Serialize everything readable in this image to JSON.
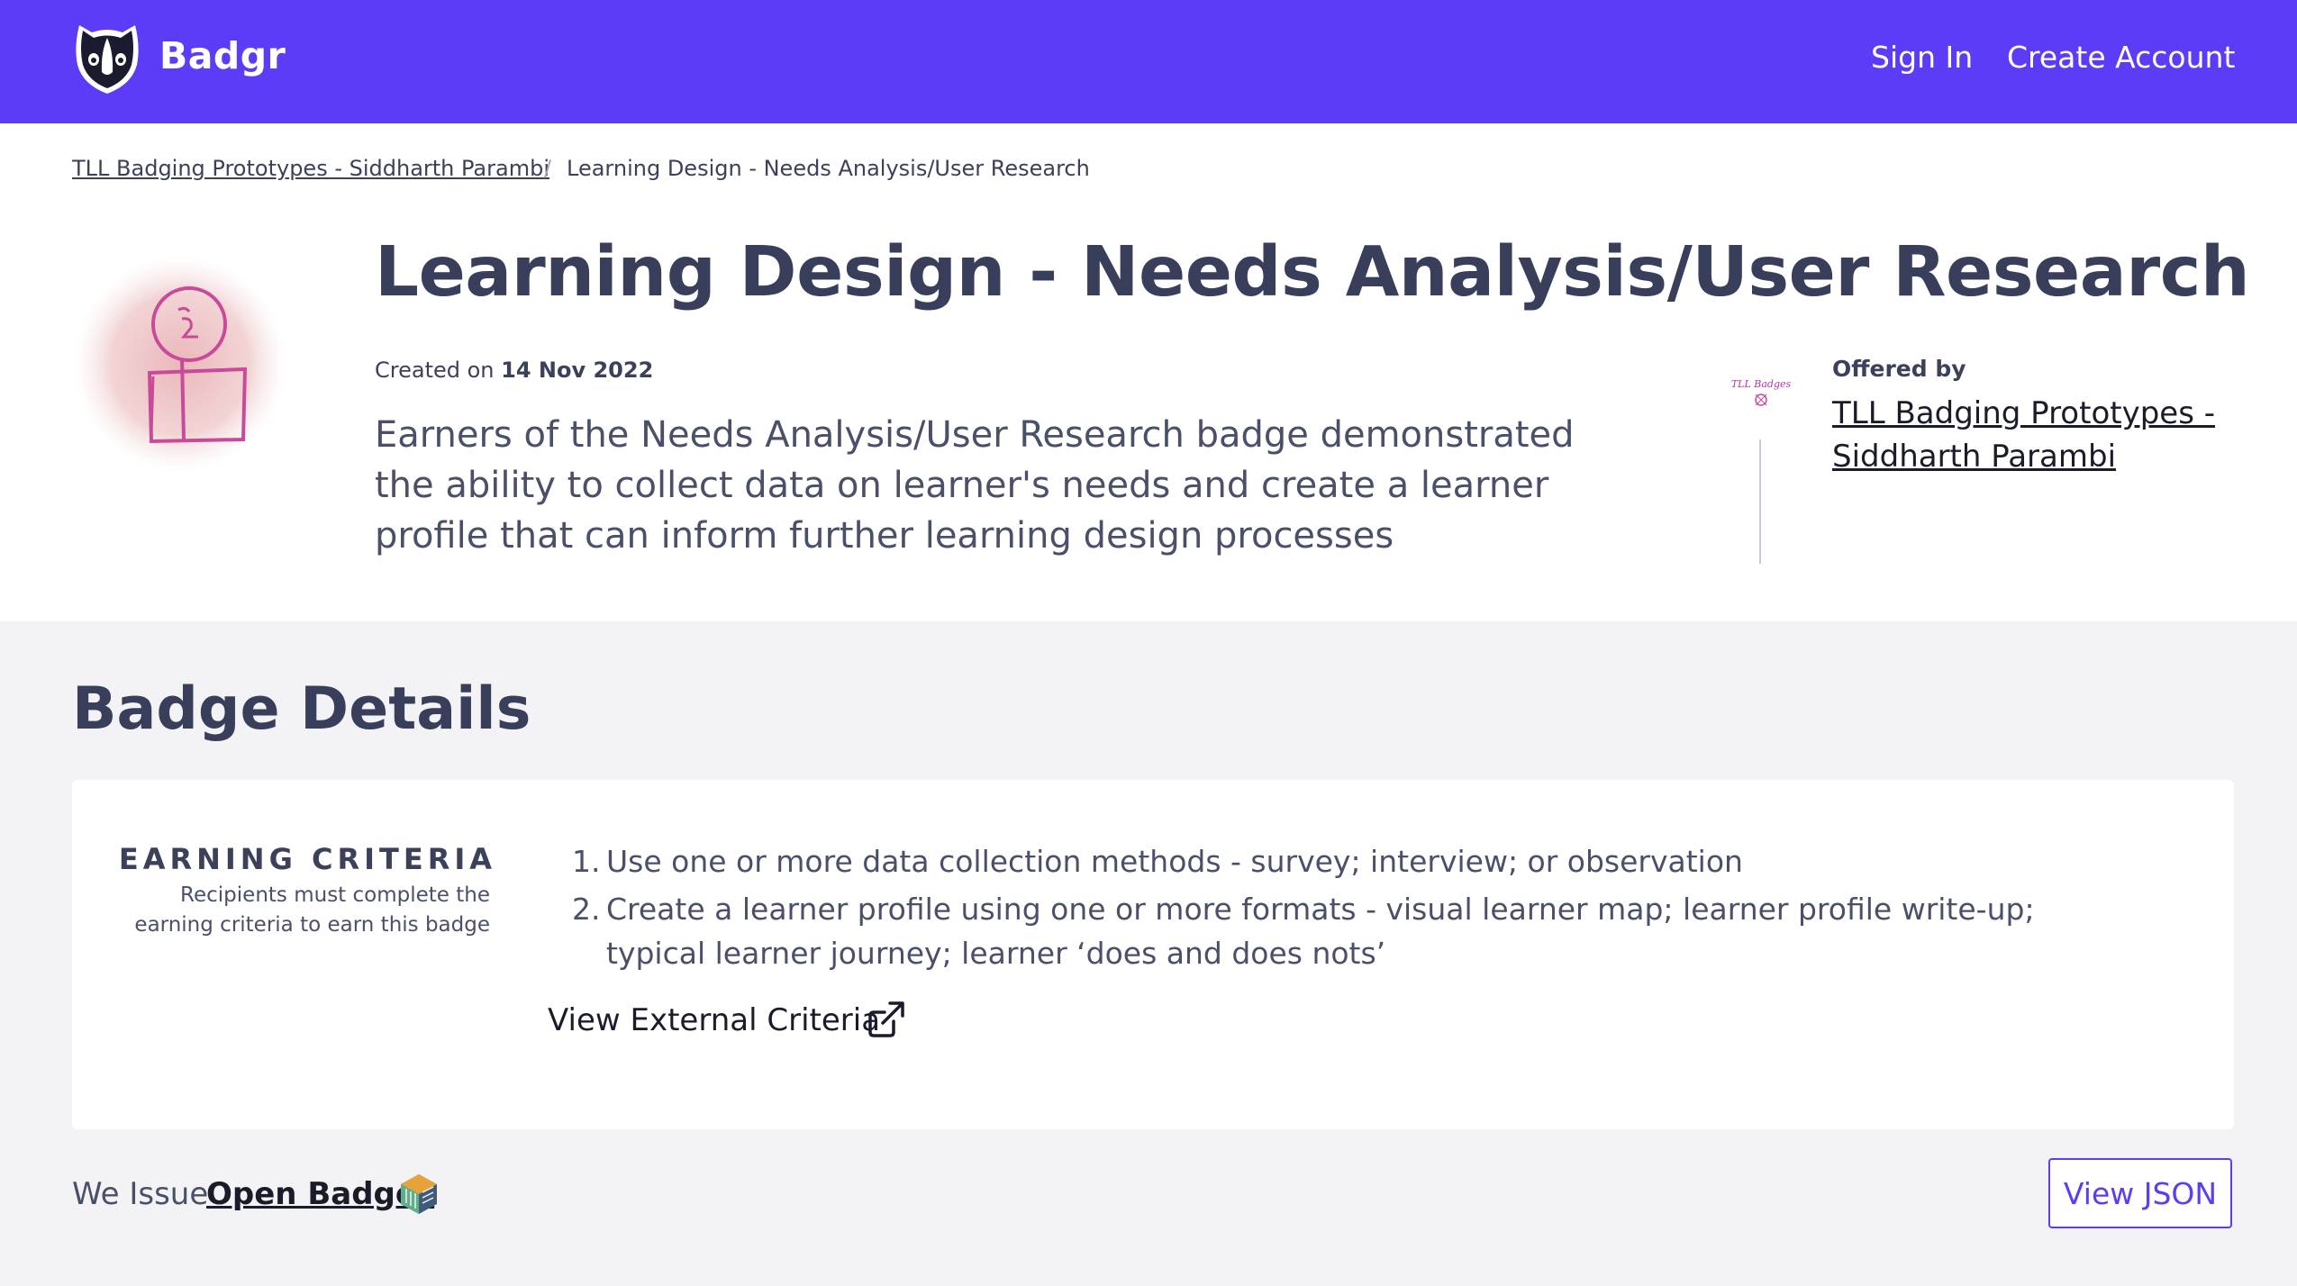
{
  "header": {
    "brand": "Badgr",
    "sign_in": "Sign In",
    "create_account": "Create Account",
    "logo_icon": "badger-logo-icon"
  },
  "breadcrumb": {
    "parent": "TLL Badging Prototypes - Siddharth Parambi",
    "separator": "/",
    "current": "Learning Design - Needs Analysis/User Research"
  },
  "badge": {
    "title": "Learning Design - Needs Analysis/User Research",
    "created_prefix": "Created on",
    "created_date": "14 Nov 2022",
    "description": "Earners of the Needs Analysis/User Research badge demonstrated the ability to collect data on learner's needs and create a learner profile that can inform further learning design processes",
    "image_icon": "learner-figure-badge-image"
  },
  "issuer": {
    "offered_label": "Offered by",
    "name": "TLL Badging Prototypes - Siddharth Parambi",
    "image_text": "TLL Badges"
  },
  "details": {
    "section_title": "Badge Details",
    "criteria_heading": "EARNING CRITERIA",
    "criteria_subtext": "Recipients must complete the earning criteria to earn this badge",
    "criteria": [
      {
        "num": "1.",
        "text": "Use one or more data collection methods - survey; interview; or observation"
      },
      {
        "num": "2.",
        "text": "Create a learner profile using one or more formats - visual learner map; learner profile write-up; typical learner journey; learner ‘does and does nots’"
      }
    ],
    "external_link": "View External Criteria",
    "external_icon": "external-link-icon"
  },
  "footer": {
    "we_issue": "We Issue",
    "open_badges": "Open Badges",
    "open_badges_icon": "open-badges-logo-icon",
    "view_json": "View JSON"
  },
  "colors": {
    "brand": "#5c3cf7",
    "text": "#3b4159",
    "background": "#f3f3f5"
  }
}
